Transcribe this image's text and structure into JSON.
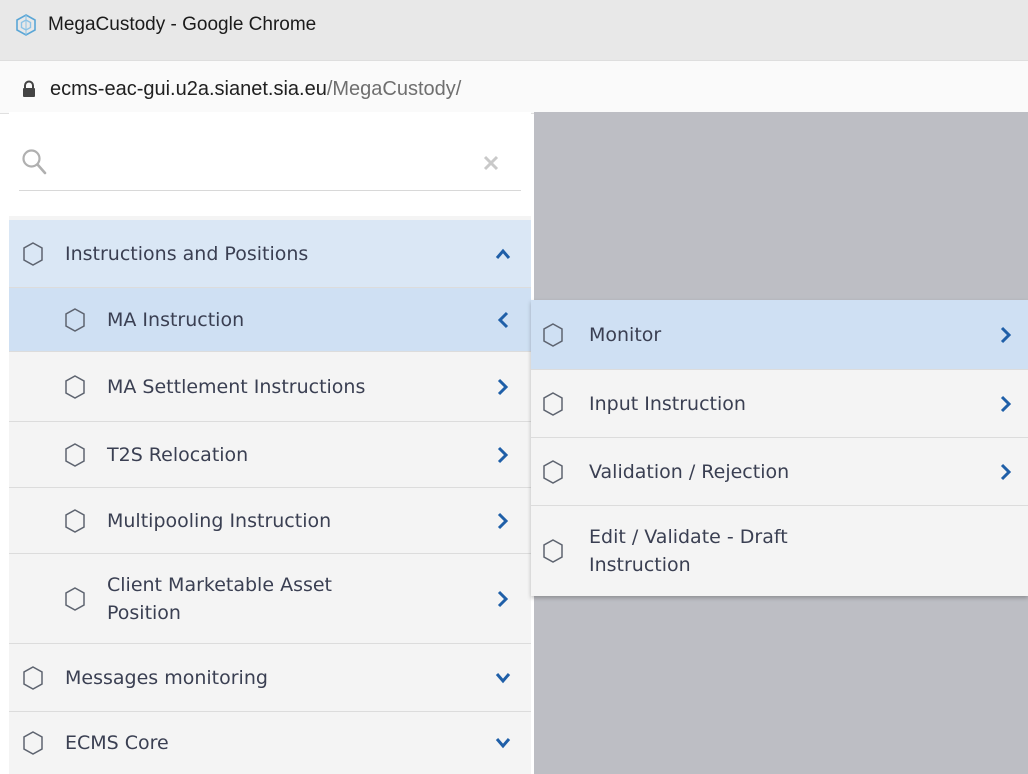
{
  "window": {
    "title": "MegaCustody - Google Chrome",
    "url_host": "ecms-eac-gui.u2a.sianet.sia.eu",
    "url_path": "/MegaCustody/"
  },
  "colors": {
    "accent": "#1f5fa8",
    "menu_bg": "#f4f4f4",
    "active_bg": "#cfe0f3",
    "panel_gray": "#bdbec4"
  },
  "search": {
    "value": "",
    "placeholder": "",
    "icon": "search-icon",
    "clear_icon": "close-icon"
  },
  "menu": {
    "items": [
      {
        "label": "Instructions and Positions",
        "icon": "hexagon-icon",
        "state": "expanded"
      },
      {
        "label": "MA Instruction",
        "icon": "hexagon-icon",
        "state": "selected",
        "chevron": "chevron-left-icon"
      },
      {
        "label": "MA Settlement Instructions",
        "icon": "hexagon-icon",
        "chevron": "chevron-right-icon"
      },
      {
        "label": "T2S Relocation",
        "icon": "hexagon-icon",
        "chevron": "chevron-right-icon"
      },
      {
        "label": "Multipooling Instruction",
        "icon": "hexagon-icon",
        "chevron": "chevron-right-icon"
      },
      {
        "label_line1": "Client Marketable Asset",
        "label_line2": "Position",
        "icon": "hexagon-icon",
        "chevron": "chevron-right-icon"
      },
      {
        "label": "Messages monitoring",
        "icon": "hexagon-icon",
        "state": "collapsed"
      },
      {
        "label": "ECMS Core",
        "icon": "hexagon-icon",
        "state": "collapsed"
      }
    ]
  },
  "submenu": {
    "items": [
      {
        "label": "Monitor",
        "icon": "hexagon-icon",
        "state": "hover",
        "chevron": "chevron-right-icon"
      },
      {
        "label": "Input Instruction",
        "icon": "hexagon-icon",
        "chevron": "chevron-right-icon"
      },
      {
        "label": "Validation / Rejection",
        "icon": "hexagon-icon",
        "chevron": "chevron-right-icon"
      },
      {
        "label_line1": "Edit / Validate - Draft",
        "label_line2": "Instruction",
        "icon": "hexagon-icon"
      }
    ]
  }
}
